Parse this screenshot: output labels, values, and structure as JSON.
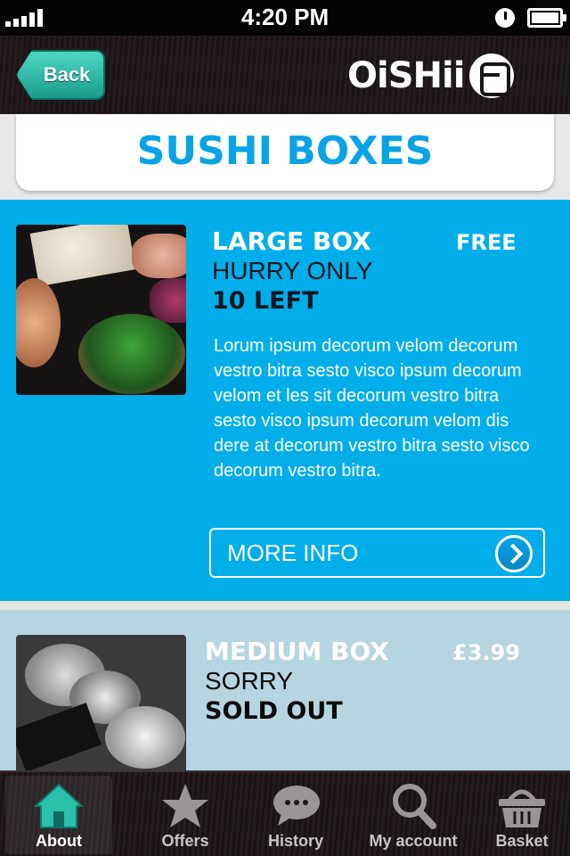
{
  "status_bar": {
    "time": "4:20 PM"
  },
  "nav": {
    "back_label": "Back",
    "logo_text": "OiSHii"
  },
  "page": {
    "title": "SUSHI BOXES"
  },
  "products": [
    {
      "name": "LARGE BOX",
      "price": "FREE",
      "status": "HURRY ONLY",
      "status_strong": "10 LEFT",
      "description": "Lorum ipsum decorum velom decorum vestro bitra sesto visco ipsum decorum velom et les sit decorum vestro bitra sesto visco ipsum decorum velom dis dere at decorum vestro bitra sesto visco decorum vestro bitra.",
      "more_info_label": "MORE INFO"
    },
    {
      "name": "MEDIUM BOX",
      "price": "£3.99",
      "status": "SORRY",
      "status_strong": "SOLD OUT"
    }
  ],
  "tabs": [
    {
      "label": "About",
      "icon": "home-icon",
      "active": true
    },
    {
      "label": "Offers",
      "icon": "star-icon"
    },
    {
      "label": "History",
      "icon": "chat-bubble-icon"
    },
    {
      "label": "My account",
      "icon": "search-icon"
    },
    {
      "label": "Basket",
      "icon": "basket-icon"
    }
  ],
  "colors": {
    "accent_blue": "#02aeea",
    "title_blue": "#0aa3e6",
    "back_teal": "#2bb8a6",
    "sold_out_panel": "#b5d5e1"
  }
}
